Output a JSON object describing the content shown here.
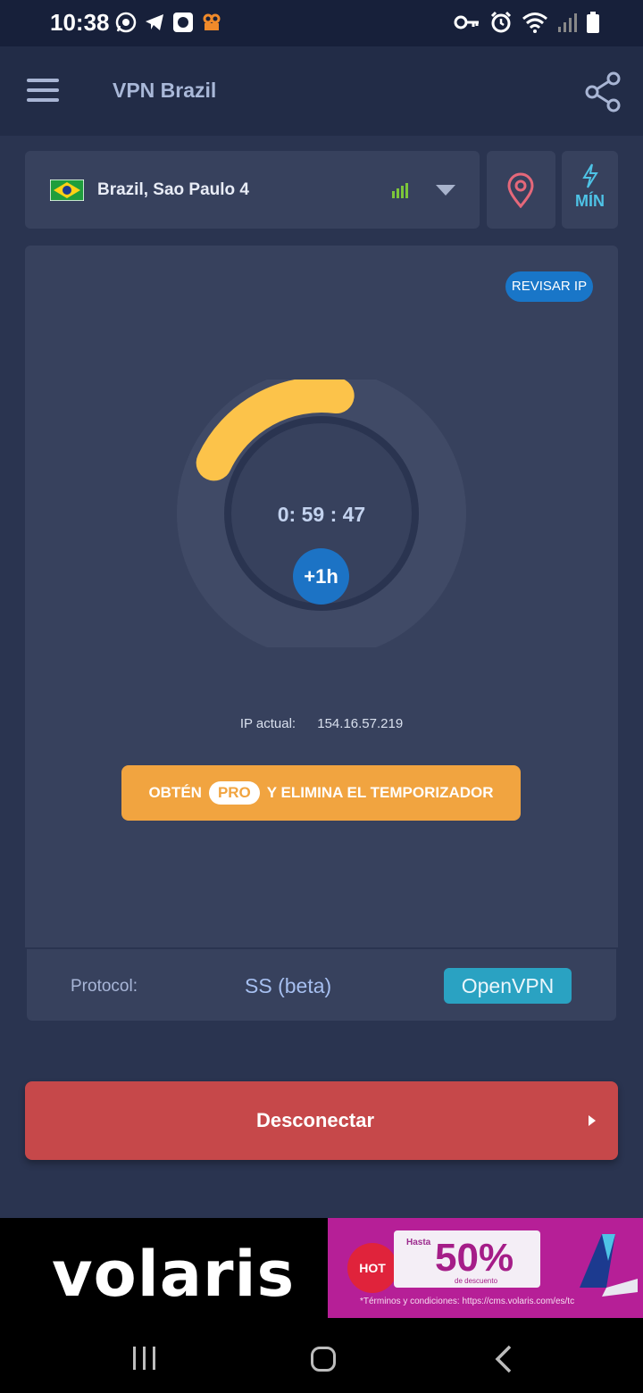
{
  "status_bar": {
    "time": "10:38",
    "app_icons": [
      "whatsapp-icon",
      "telegram-icon",
      "app-icon",
      "video-icon"
    ],
    "system_icons": [
      "vpn-key-icon",
      "alarm-icon",
      "wifi-icon",
      "signal-icon",
      "battery-icon"
    ]
  },
  "app_bar": {
    "title": "VPN Brazil",
    "menu_icon": "hamburger-menu-icon",
    "share_icon": "share-icon"
  },
  "server": {
    "flag": "brazil-flag-icon",
    "name": "Brazil, Sao Paulo 4",
    "signal_color": "#7cc63a"
  },
  "speed_mode": {
    "label": "MÍN",
    "icon": "lightning-icon"
  },
  "connection": {
    "check_ip_label": "REVISAR IP",
    "timer": "0: 59 : 47",
    "add_time_label": "+1h",
    "timer_fraction_remaining": 0.2,
    "ip_label": "IP actual:",
    "ip_value": "154.16.57.219"
  },
  "promo_button": {
    "text_before": "OBTÉN",
    "pill": "PRO",
    "text_after": "Y ELIMINA EL TEMPORIZADOR"
  },
  "protocol": {
    "label": "Protocol:",
    "options": [
      "SS (beta)",
      "OpenVPN"
    ],
    "selected": "OpenVPN"
  },
  "disconnect_button": {
    "label": "Desconectar"
  },
  "ad": {
    "brand": "volaris",
    "hot_label": "HOT",
    "hasta": "Hasta",
    "discount": "50%",
    "discount_sub": "de descuento",
    "terms": "*Términos y condiciones: https://cms.volaris.com/es/tc"
  },
  "nav_bar": {
    "icons": [
      "recents-icon",
      "home-icon",
      "back-icon"
    ]
  },
  "colors": {
    "background": "#2a3450",
    "card": "#37415d",
    "accent_blue": "#1976c8",
    "progress_yellow": "#fcc34a",
    "promo_orange": "#f1a440",
    "disconnect_red": "#c6484a",
    "openvpn_teal": "#2aa2c2"
  }
}
